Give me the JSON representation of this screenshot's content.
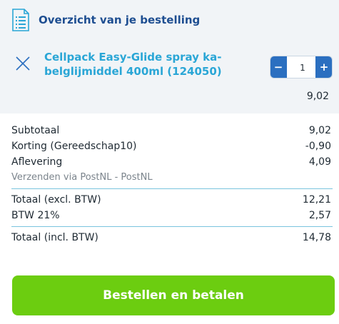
{
  "header": {
    "title": "Overzicht van je bestelling",
    "icon": "document-list-icon"
  },
  "product": {
    "name": "Cellpack Easy-Glide spray ka-belglijmiddel 400ml (124050)",
    "name_line1": "Cellpack Easy-Glide spray ka-",
    "name_line2": "belglijmiddel 400ml (124050)",
    "quantity": "1",
    "minus_label": "−",
    "plus_label": "+",
    "price": "9,02"
  },
  "summary": {
    "rows": [
      {
        "label": "Subtotaal",
        "value": "9,02"
      },
      {
        "label": "Korting (Gereedschap10)",
        "value": "-0,90"
      },
      {
        "label": "Aflevering",
        "value": "4,09"
      }
    ],
    "shipping_note": "Verzenden via PostNL - PostNL",
    "total_excl": {
      "label": "Totaal (excl. BTW)",
      "value": "12,21"
    },
    "vat": {
      "label": "BTW 21%",
      "value": "2,57"
    },
    "total_incl": {
      "label": "Totaal (incl. BTW)",
      "value": "14,78"
    }
  },
  "checkout": {
    "label": "Bestellen en betalen"
  },
  "colors": {
    "title": "#1e4e91",
    "product_name": "#2aa6d6",
    "stepper": "#2b6fc0",
    "checkout": "#6ccd10",
    "divider": "#7ac4de"
  }
}
